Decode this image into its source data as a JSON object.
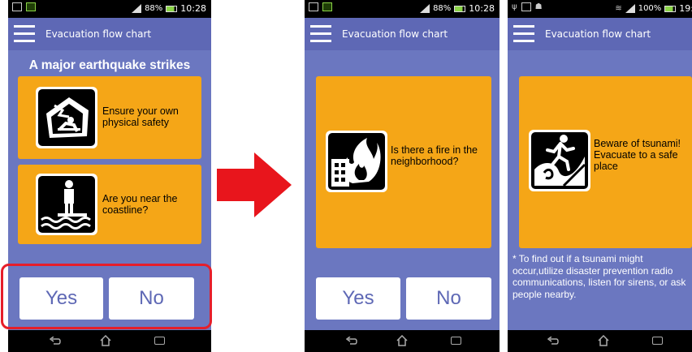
{
  "screens": [
    {
      "status_time": "10:28",
      "status_battery": "88%",
      "app_title": "Evacuation flow chart",
      "heading": "A major earthquake strikes",
      "cards": [
        {
          "text": "Ensure your own physical safety",
          "icon": "collapsing-house-icon"
        },
        {
          "text": "Are you near the coastline?",
          "icon": "coastline-person-icon"
        }
      ],
      "buttons": {
        "yes": "Yes",
        "no": "No"
      }
    },
    {
      "status_time": "10:28",
      "status_battery": "88%",
      "app_title": "Evacuation flow chart",
      "cards": [
        {
          "text": "Is there a fire in the neighborhood?",
          "icon": "fire-building-icon"
        }
      ],
      "buttons": {
        "yes": "Yes",
        "no": "No"
      }
    },
    {
      "status_time": "19:",
      "status_battery": "100%",
      "app_title": "Evacuation flow chart",
      "cards": [
        {
          "text": "Beware of tsunami! Evacuate to a safe place",
          "icon": "tsunami-run-icon"
        }
      ],
      "note": "* To find out if a tsunami might occur,utilize disaster prevention radio communications, listen for sirens, or ask people nearby."
    }
  ],
  "colors": {
    "background": "#6b77c0",
    "appbar": "#5e68b5",
    "card": "#f5a617",
    "highlight": "#e61e2a",
    "arrow": "#e8151c"
  }
}
